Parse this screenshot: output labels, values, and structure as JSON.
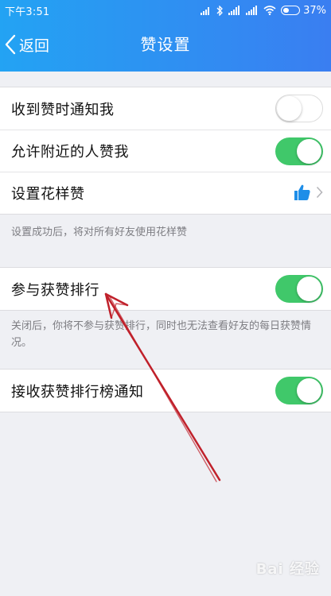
{
  "status_bar": {
    "time": "下午3:51",
    "battery": "37%"
  },
  "nav": {
    "back_label": "返回",
    "title": "赞设置"
  },
  "settings": {
    "notify_on_like": {
      "label": "收到赞时通知我",
      "enabled": false
    },
    "allow_nearby": {
      "label": "允许附近的人赞我",
      "enabled": true
    },
    "fancy_like": {
      "label": "设置花样赞"
    },
    "fancy_note": "设置成功后，将对所有好友使用花样赞",
    "ranking": {
      "label": "参与获赞排行",
      "enabled": true
    },
    "ranking_note": "关闭后，你将不参与获赞排行，同时也无法查看好友的每日获赞情况。",
    "ranking_notify": {
      "label": "接收获赞排行榜通知",
      "enabled": true
    }
  },
  "colors": {
    "header_start": "#23a3f3",
    "header_end": "#3a7ef1",
    "toggle_on": "#40c86a",
    "arrow": "#c0212b",
    "thumb_icon": "#1e8ee8"
  },
  "watermark": "Bai 经验"
}
